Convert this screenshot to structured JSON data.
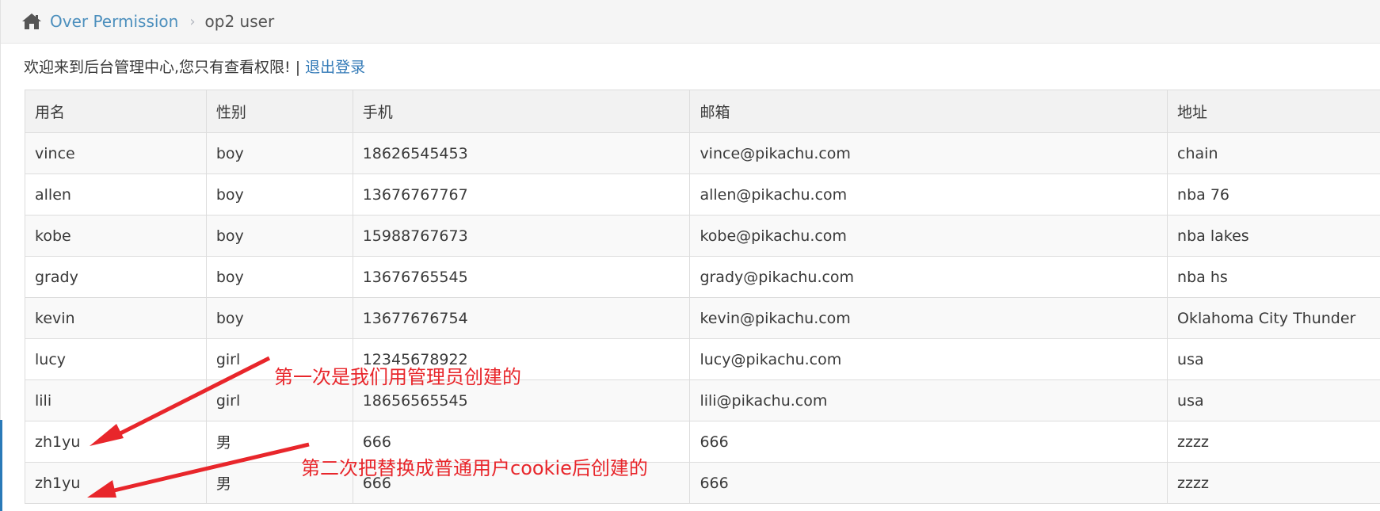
{
  "breadcrumb": {
    "home_icon": "home-icon",
    "link": "Over Permission",
    "current": "op2 user"
  },
  "welcome": {
    "text": "欢迎来到后台管理中心,您只有查看权限! | ",
    "logout": "退出登录"
  },
  "table": {
    "headers": [
      "用名",
      "性别",
      "手机",
      "邮箱",
      "地址"
    ],
    "rows": [
      [
        "vince",
        "boy",
        "18626545453",
        "vince@pikachu.com",
        "chain"
      ],
      [
        "allen",
        "boy",
        "13676767767",
        "allen@pikachu.com",
        "nba 76"
      ],
      [
        "kobe",
        "boy",
        "15988767673",
        "kobe@pikachu.com",
        "nba lakes"
      ],
      [
        "grady",
        "boy",
        "13676765545",
        "grady@pikachu.com",
        "nba hs"
      ],
      [
        "kevin",
        "boy",
        "13677676754",
        "kevin@pikachu.com",
        "Oklahoma City Thunder"
      ],
      [
        "lucy",
        "girl",
        "12345678922",
        "lucy@pikachu.com",
        "usa"
      ],
      [
        "lili",
        "girl",
        "18656565545",
        "lili@pikachu.com",
        "usa"
      ],
      [
        "zh1yu",
        "男",
        "666",
        "666",
        "zzzz"
      ],
      [
        "zh1yu",
        "男",
        "666",
        "666",
        "zzzz"
      ]
    ]
  },
  "annotations": {
    "note_1": "第一次是我们用管理员创建的",
    "note_2": "第二次把替换成普通用户cookie后创建的",
    "arrow_color": "#e8262b"
  },
  "colors": {
    "link": "#4c8fbd",
    "logout": "#337ab7",
    "accent": "#2a7ab8"
  }
}
